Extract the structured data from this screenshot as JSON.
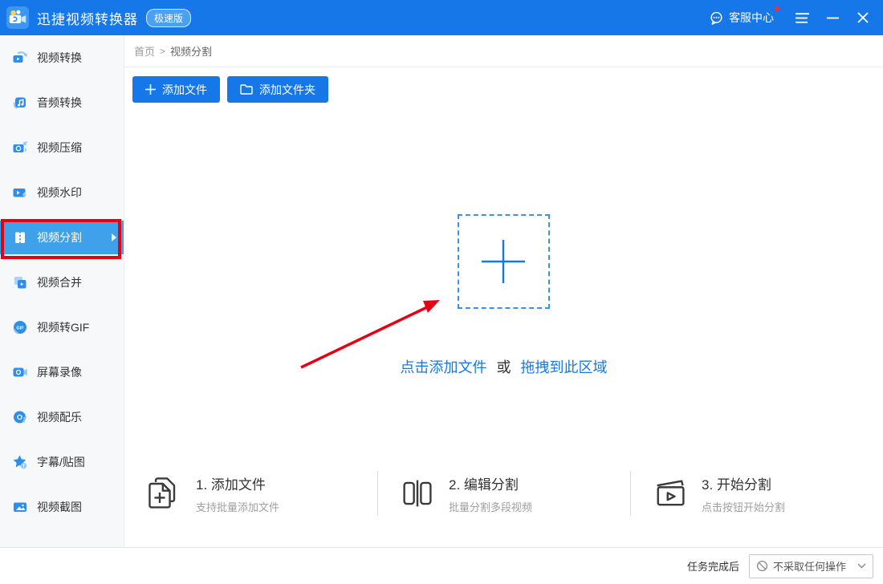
{
  "titlebar": {
    "app_title": "迅捷视频转换器",
    "badge": "极速版",
    "service_label": "客服中心"
  },
  "sidebar": {
    "items": [
      {
        "label": "视频转换"
      },
      {
        "label": "音频转换"
      },
      {
        "label": "视频压缩"
      },
      {
        "label": "视频水印"
      },
      {
        "label": "视频分割",
        "selected": true
      },
      {
        "label": "视频合并"
      },
      {
        "label": "视频转GIF"
      },
      {
        "label": "屏幕录像"
      },
      {
        "label": "视频配乐"
      },
      {
        "label": "字幕/贴图"
      },
      {
        "label": "视频截图"
      }
    ]
  },
  "breadcrumb": {
    "home": "首页",
    "separator": ">",
    "current": "视频分割"
  },
  "toolbar": {
    "add_file": "添加文件",
    "add_folder": "添加文件夹"
  },
  "dropzone": {
    "click_text": "点击添加文件",
    "or_text": "或",
    "drag_text": "拖拽到此区域"
  },
  "steps": [
    {
      "title": "1. 添加文件",
      "subtitle": "支持批量添加文件"
    },
    {
      "title": "2. 编辑分割",
      "subtitle": "批量分割多段视频"
    },
    {
      "title": "3. 开始分割",
      "subtitle": "点击按钮开始分割"
    }
  ],
  "statusbar": {
    "label": "任务完成后",
    "selected_option": "不采取任何操作"
  },
  "colors": {
    "titlebar_blue": "#1577E8",
    "accent_blue": "#1678E8",
    "selected_item_blue": "#3EA1E9",
    "annotation_red": "#E60012",
    "sidebar_bg": "#F7F8F9"
  }
}
